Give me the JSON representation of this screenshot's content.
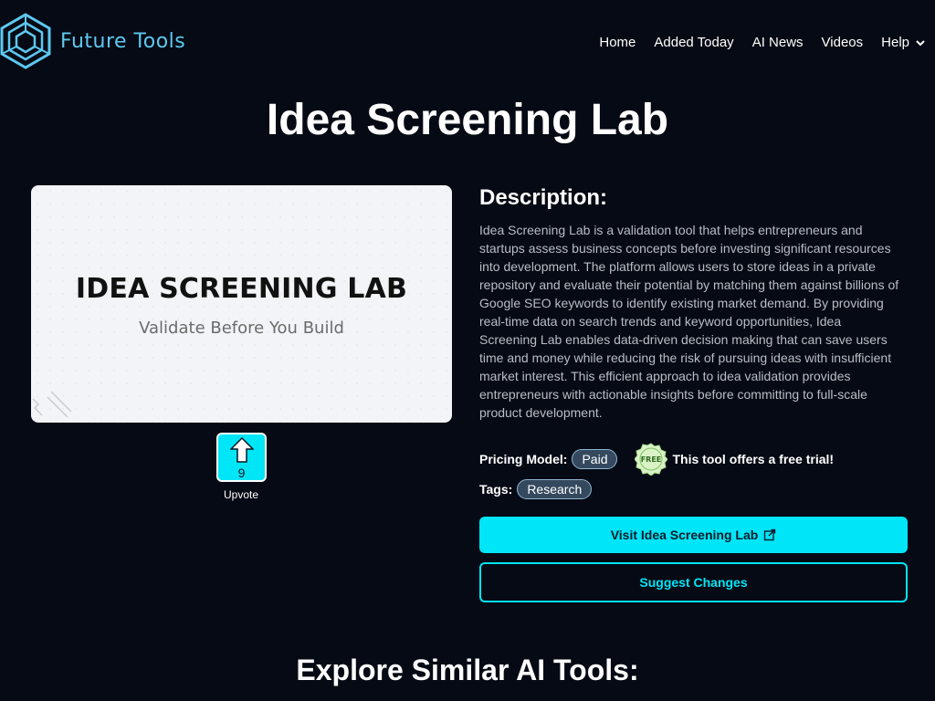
{
  "brand": {
    "name": "Future Tools",
    "logo_icon": "hexagon-cube-logo-icon",
    "accent": "#5ec8f0"
  },
  "nav": {
    "items": [
      {
        "label": "Home"
      },
      {
        "label": "Added Today"
      },
      {
        "label": "AI News"
      },
      {
        "label": "Videos"
      },
      {
        "label": "Help",
        "icon": "chevron-down-icon"
      }
    ]
  },
  "page": {
    "title": "Idea Screening Lab"
  },
  "hero": {
    "title": "IDEA SCREENING LAB",
    "subtitle": "Validate Before You Build"
  },
  "upvote": {
    "count": "9",
    "label": "Upvote",
    "icon": "arrow-up-icon",
    "color": "#00e6f6"
  },
  "description": {
    "heading": "Description:",
    "text": "Idea Screening Lab is a validation tool that helps entrepreneurs and startups assess business concepts before investing significant resources into development. The platform allows users to store ideas in a private repository and evaluate their potential by matching them against billions of Google SEO keywords to identify existing market demand. By providing real-time data on search trends and keyword opportunities, Idea Screening Lab enables data-driven decision making that can save users time and money while reducing the risk of pursuing ideas with insufficient market interest. This efficient approach to idea validation provides entrepreneurs with actionable insights before committing to full-scale product development."
  },
  "pricing": {
    "label": "Pricing Model:",
    "value": "Paid",
    "badge_text": "FREE",
    "trial_text": "This tool offers a free trial!"
  },
  "tags": {
    "label": "Tags:",
    "items": [
      "Research"
    ]
  },
  "actions": {
    "visit_label": "Visit Idea Screening Lab",
    "visit_icon": "external-link-icon",
    "suggest_label": "Suggest Changes",
    "accent": "#00e5f7"
  },
  "explore": {
    "heading": "Explore Similar AI Tools:"
  }
}
